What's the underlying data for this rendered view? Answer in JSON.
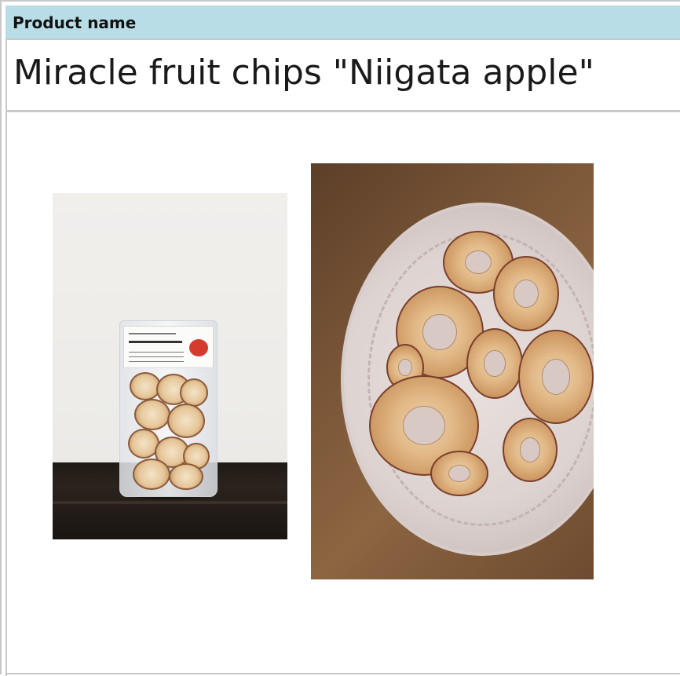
{
  "header": {
    "label": "Product name"
  },
  "product": {
    "name": "Miracle fruit chips \"Niigata apple\""
  },
  "images": [
    {
      "subject": "packaged-apple-chips-bag"
    },
    {
      "subject": "apple-chips-on-plate"
    }
  ],
  "colors": {
    "header_background": "#b9dde6",
    "border": "#c8c8c8",
    "text": "#1a1a1a"
  }
}
